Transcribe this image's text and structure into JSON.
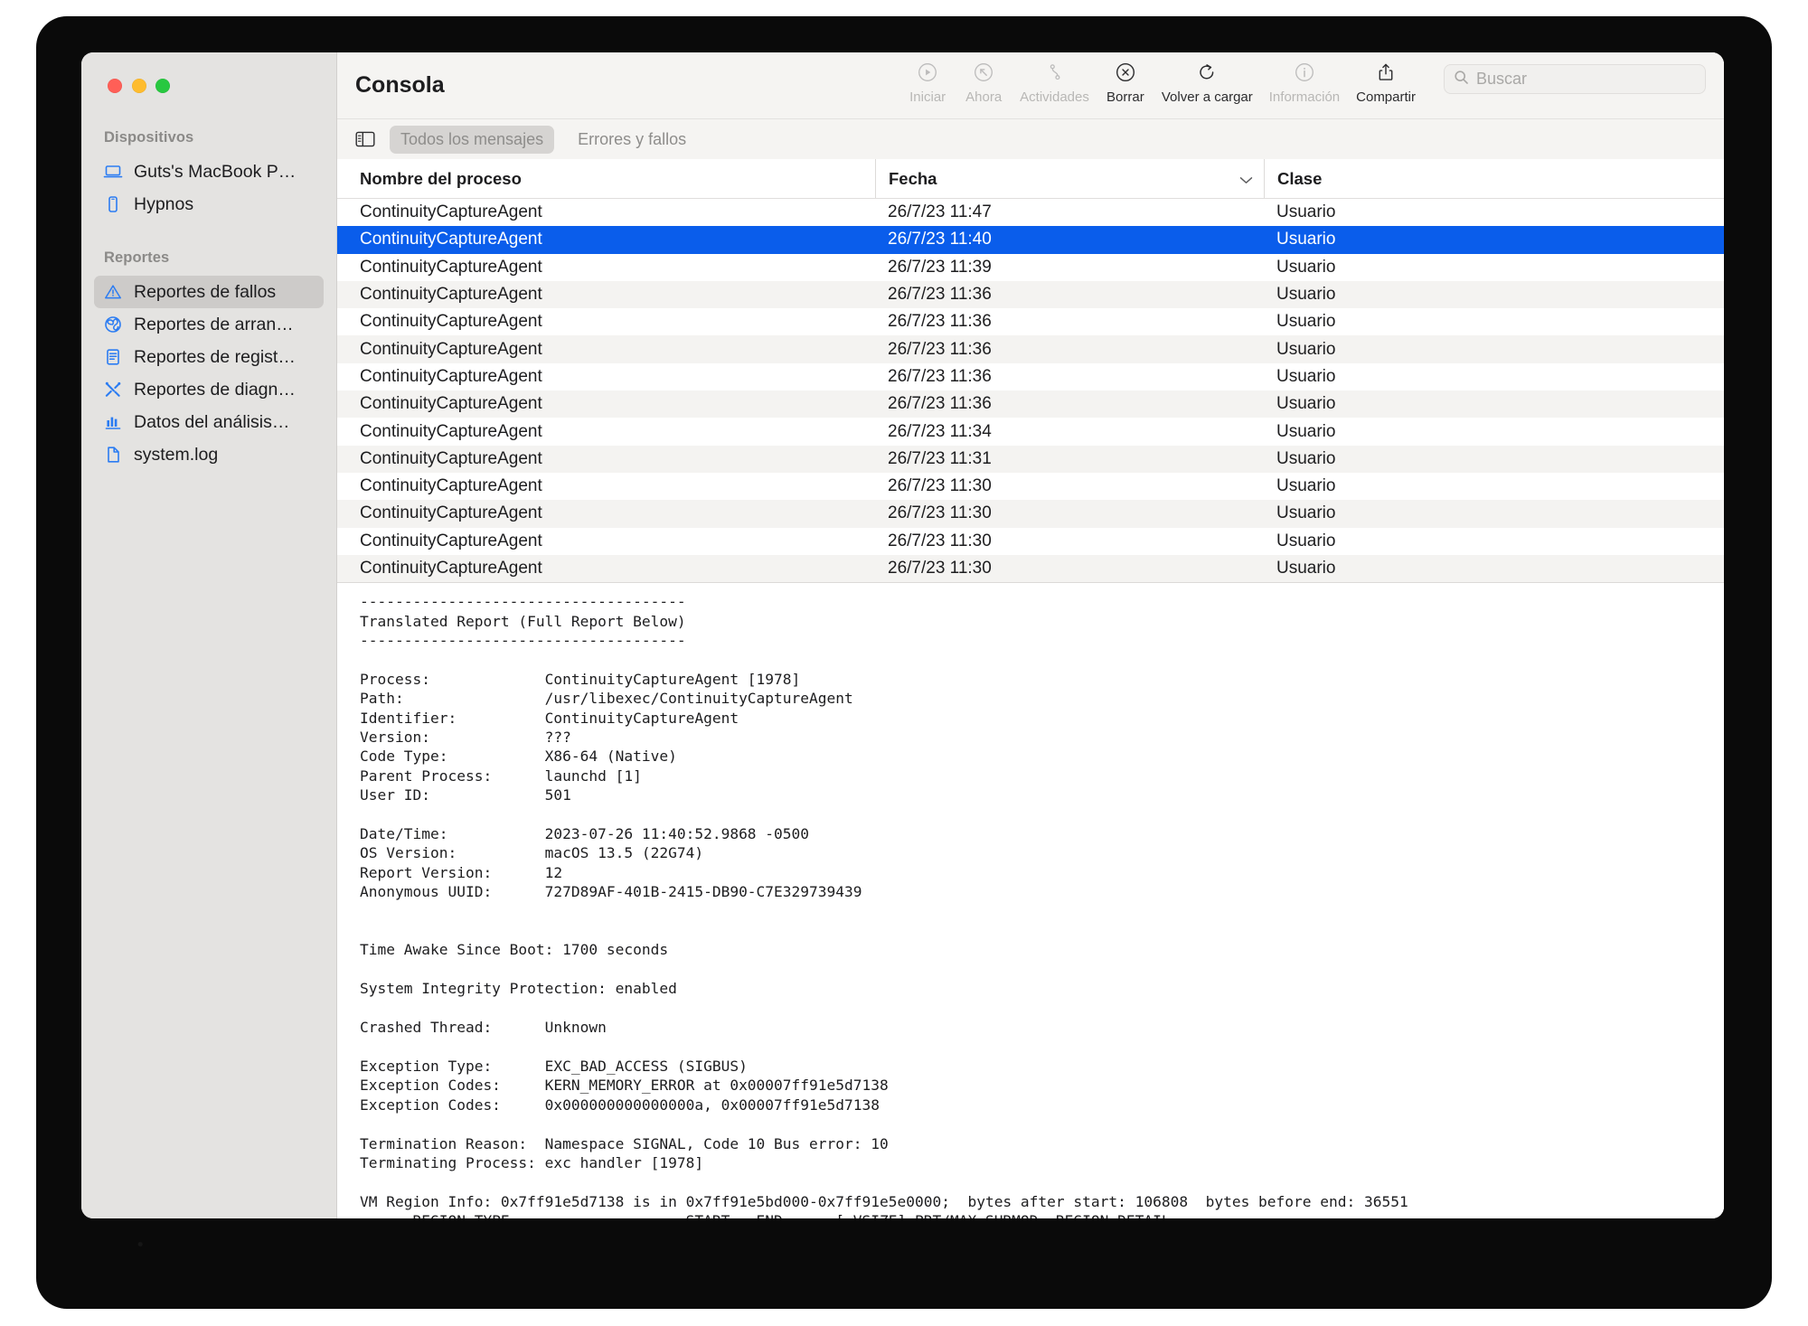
{
  "window": {
    "title": "Consola",
    "traffic_lights": [
      "close",
      "minimize",
      "zoom"
    ]
  },
  "toolbar": {
    "buttons": [
      {
        "label": "Iniciar",
        "icon": "play-circle-icon",
        "enabled": false
      },
      {
        "label": "Ahora",
        "icon": "now-arrow-icon",
        "enabled": false
      },
      {
        "label": "Actividades",
        "icon": "activities-icon",
        "enabled": false
      },
      {
        "label": "Borrar",
        "icon": "clear-x-circle-icon",
        "enabled": true
      },
      {
        "label": "Volver a cargar",
        "icon": "reload-icon",
        "enabled": true
      },
      {
        "label": "Información",
        "icon": "info-circle-icon",
        "enabled": false
      },
      {
        "label": "Compartir",
        "icon": "share-icon",
        "enabled": true
      }
    ],
    "search": {
      "placeholder": "Buscar",
      "value": "",
      "icon": "search-icon"
    }
  },
  "filterbar": {
    "sidebar_toggle_icon": "sidebar-toggle-icon",
    "segments": [
      {
        "label": "Todos los mensajes",
        "active": true
      },
      {
        "label": "Errores y fallos",
        "active": false
      }
    ]
  },
  "sidebar": {
    "groups": [
      {
        "title": "Dispositivos",
        "items": [
          {
            "label": "Guts's MacBook P…",
            "icon": "laptop-icon",
            "selected": false
          },
          {
            "label": "Hypnos",
            "icon": "iphone-icon",
            "selected": false
          }
        ]
      },
      {
        "title": "Reportes",
        "items": [
          {
            "label": "Reportes de fallos",
            "icon": "warning-triangle-icon",
            "selected": true
          },
          {
            "label": "Reportes de arran…",
            "icon": "spinner-icon",
            "selected": false
          },
          {
            "label": "Reportes de regist…",
            "icon": "log-document-icon",
            "selected": false
          },
          {
            "label": "Reportes de diagn…",
            "icon": "tools-icon",
            "selected": false
          },
          {
            "label": "Datos del análisis…",
            "icon": "bar-chart-icon",
            "selected": false
          },
          {
            "label": "system.log",
            "icon": "file-icon",
            "selected": false
          }
        ]
      }
    ]
  },
  "table": {
    "columns": [
      "Nombre del proceso",
      "Fecha",
      "Clase"
    ],
    "sort_indicator_icon": "chevron-down-icon",
    "rows": [
      {
        "process": "ContinuityCaptureAgent",
        "date": "26/7/23 11:47",
        "class": "Usuario",
        "selected": false
      },
      {
        "process": "ContinuityCaptureAgent",
        "date": "26/7/23 11:40",
        "class": "Usuario",
        "selected": true
      },
      {
        "process": "ContinuityCaptureAgent",
        "date": "26/7/23 11:39",
        "class": "Usuario",
        "selected": false
      },
      {
        "process": "ContinuityCaptureAgent",
        "date": "26/7/23 11:36",
        "class": "Usuario",
        "selected": false
      },
      {
        "process": "ContinuityCaptureAgent",
        "date": "26/7/23 11:36",
        "class": "Usuario",
        "selected": false
      },
      {
        "process": "ContinuityCaptureAgent",
        "date": "26/7/23 11:36",
        "class": "Usuario",
        "selected": false
      },
      {
        "process": "ContinuityCaptureAgent",
        "date": "26/7/23 11:36",
        "class": "Usuario",
        "selected": false
      },
      {
        "process": "ContinuityCaptureAgent",
        "date": "26/7/23 11:36",
        "class": "Usuario",
        "selected": false
      },
      {
        "process": "ContinuityCaptureAgent",
        "date": "26/7/23 11:34",
        "class": "Usuario",
        "selected": false
      },
      {
        "process": "ContinuityCaptureAgent",
        "date": "26/7/23 11:31",
        "class": "Usuario",
        "selected": false
      },
      {
        "process": "ContinuityCaptureAgent",
        "date": "26/7/23 11:30",
        "class": "Usuario",
        "selected": false
      },
      {
        "process": "ContinuityCaptureAgent",
        "date": "26/7/23 11:30",
        "class": "Usuario",
        "selected": false
      },
      {
        "process": "ContinuityCaptureAgent",
        "date": "26/7/23 11:30",
        "class": "Usuario",
        "selected": false
      },
      {
        "process": "ContinuityCaptureAgent",
        "date": "26/7/23 11:30",
        "class": "Usuario",
        "selected": false
      }
    ]
  },
  "detail": {
    "report_text": "-------------------------------------\nTranslated Report (Full Report Below)\n-------------------------------------\n\nProcess:             ContinuityCaptureAgent [1978]\nPath:                /usr/libexec/ContinuityCaptureAgent\nIdentifier:          ContinuityCaptureAgent\nVersion:             ???\nCode Type:           X86-64 (Native)\nParent Process:      launchd [1]\nUser ID:             501\n\nDate/Time:           2023-07-26 11:40:52.9868 -0500\nOS Version:          macOS 13.5 (22G74)\nReport Version:      12\nAnonymous UUID:      727D89AF-401B-2415-DB90-C7E329739439\n\n\nTime Awake Since Boot: 1700 seconds\n\nSystem Integrity Protection: enabled\n\nCrashed Thread:      Unknown\n\nException Type:      EXC_BAD_ACCESS (SIGBUS)\nException Codes:     KERN_MEMORY_ERROR at 0x00007ff91e5d7138\nException Codes:     0x000000000000000a, 0x00007ff91e5d7138\n\nTermination Reason:  Namespace SIGNAL, Code 10 Bus error: 10\nTerminating Process: exc handler [1978]\n\nVM Region Info: 0x7ff91e5d7138 is in 0x7ff91e5bd000-0x7ff91e5e0000;  bytes after start: 106808  bytes before end: 36551\n      REGION TYPE                    START - END      [ VSIZE] PRT/MAX SHRMOD  REGION DETAIL"
  },
  "colors": {
    "selection_blue": "#0a5deb",
    "sidebar_bg": "#e4e3e1",
    "toolbar_bg": "#f5f4f2",
    "accent_icon_blue": "#2b7cf2"
  }
}
